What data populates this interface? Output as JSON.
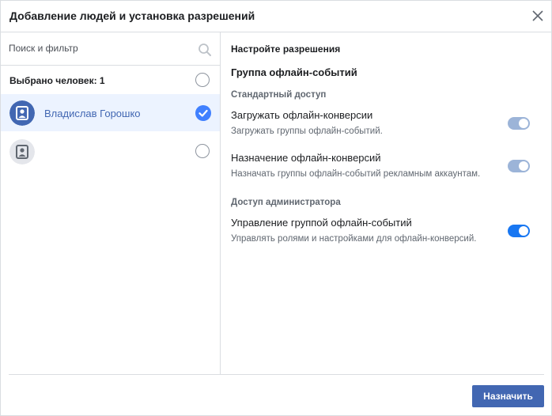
{
  "dialog": {
    "title": "Добавление людей и установка разрешений"
  },
  "left_panel": {
    "search_placeholder": "Поиск и фильтр",
    "selected_count_label": "Выбрано человек: 1",
    "people": [
      {
        "name": "Владислав Горошко",
        "selected": true
      },
      {
        "name": "",
        "selected": false
      }
    ]
  },
  "right_panel": {
    "title": "Настройте разрешения",
    "group_name": "Группа офлайн-событий",
    "sections": [
      {
        "title": "Стандартный доступ",
        "permissions": [
          {
            "name": "Загружать офлайн-конверсии",
            "description": "Загружать группы офлайн-событий.",
            "enabled": true,
            "locked": true
          },
          {
            "name": "Назначение офлайн-конверсий",
            "description": "Назначать группы офлайн-событий рекламным аккаунтам.",
            "enabled": true,
            "locked": true
          }
        ]
      },
      {
        "title": "Доступ администратора",
        "permissions": [
          {
            "name": "Управление группой офлайн-событий",
            "description": "Управлять ролями и настройками для офлайн-конверсий.",
            "enabled": true,
            "locked": false
          }
        ]
      }
    ]
  },
  "footer": {
    "assign_label": "Назначить"
  },
  "colors": {
    "accent": "#4267b2",
    "toggle_on": "#1877f2",
    "toggle_disabled": "#9cb4d8",
    "selected_row": "#ecf3ff"
  },
  "icons": [
    "close-icon",
    "search-icon",
    "user-avatar-icon",
    "check-icon"
  ]
}
